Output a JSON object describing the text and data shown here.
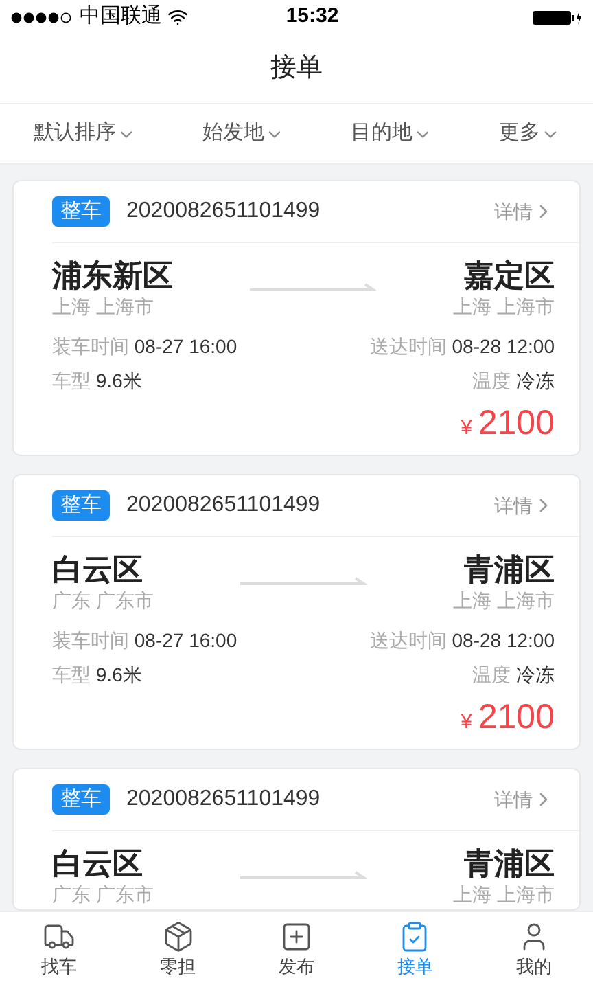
{
  "status_bar": {
    "carrier": "中国联通",
    "time": "15:32"
  },
  "title": "接单",
  "filters": [
    {
      "label": "默认排序"
    },
    {
      "label": "始发地"
    },
    {
      "label": "目的地"
    },
    {
      "label": "更多"
    }
  ],
  "orders": [
    {
      "tag": "整车",
      "number": "2020082651101499",
      "detail": "详情",
      "from": {
        "district": "浦东新区",
        "city": "上海 上海市"
      },
      "to": {
        "district": "嘉定区",
        "city": "上海 上海市"
      },
      "load_label": "装车时间",
      "load_time": "08-27 16:00",
      "arrive_label": "送达时间",
      "arrive_time": "08-28 12:00",
      "truck_label": "车型",
      "truck": "9.6米",
      "temp_label": "温度",
      "temp": "冷冻",
      "currency": "¥",
      "price": "2100"
    },
    {
      "tag": "整车",
      "number": "2020082651101499",
      "detail": "详情",
      "from": {
        "district": "白云区",
        "city": "广东 广东市"
      },
      "to": {
        "district": "青浦区",
        "city": "上海 上海市"
      },
      "load_label": "装车时间",
      "load_time": "08-27 16:00",
      "arrive_label": "送达时间",
      "arrive_time": "08-28 12:00",
      "truck_label": "车型",
      "truck": "9.6米",
      "temp_label": "温度",
      "temp": "冷冻",
      "currency": "¥",
      "price": "2100"
    },
    {
      "tag": "整车",
      "number": "2020082651101499",
      "detail": "详情",
      "from": {
        "district": "白云区",
        "city": "广东 广东市"
      },
      "to": {
        "district": "青浦区",
        "city": "上海 上海市"
      }
    }
  ],
  "tabs": [
    {
      "kind": "truck",
      "label": "找车",
      "selected": false
    },
    {
      "kind": "box",
      "label": "零担",
      "selected": false
    },
    {
      "kind": "publish",
      "label": "发布",
      "selected": false
    },
    {
      "kind": "orders",
      "label": "接单",
      "selected": true
    },
    {
      "kind": "user",
      "label": "我的",
      "selected": false
    }
  ]
}
